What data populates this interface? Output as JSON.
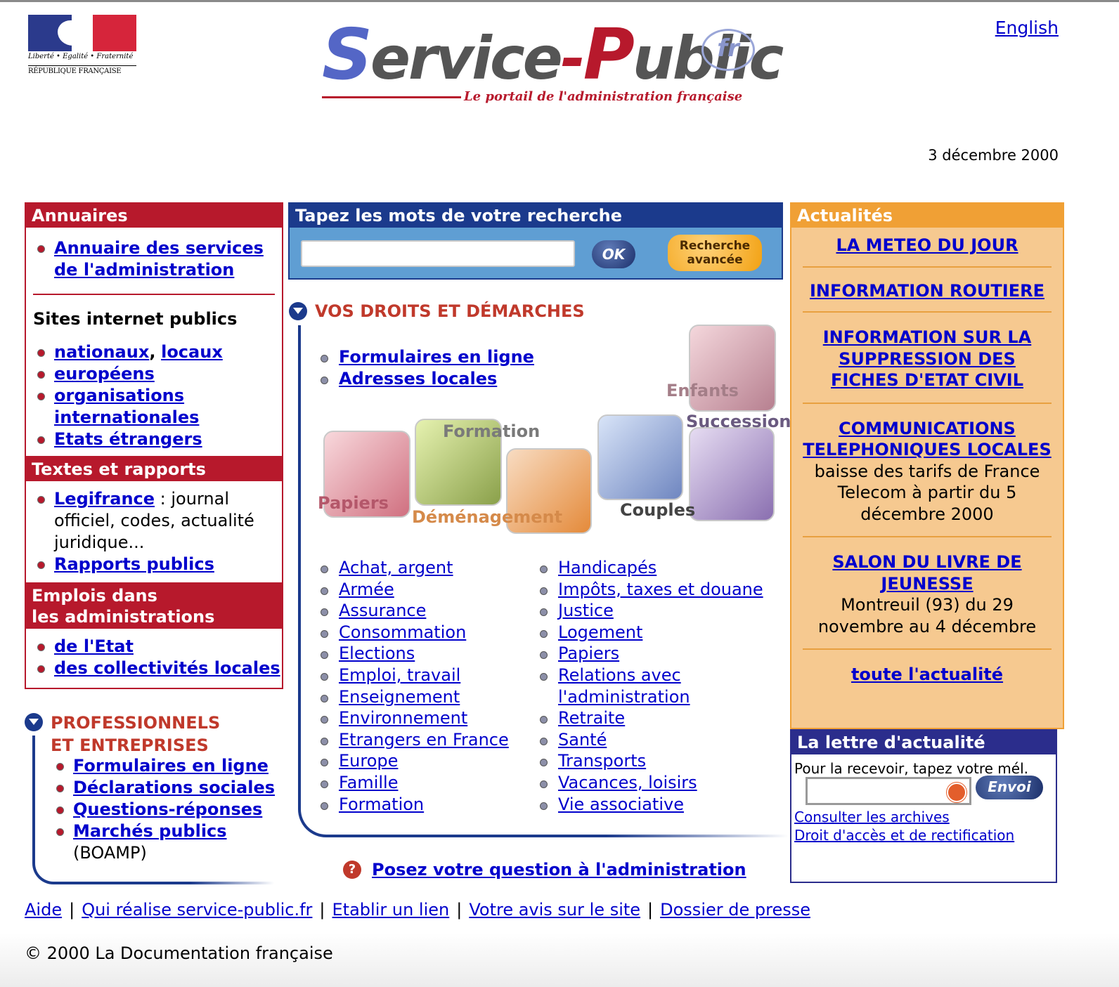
{
  "header": {
    "rf_motto": "Liberté • Egalité • Fraternité",
    "rf_name": "RÉPUBLIQUE FRANÇAISE",
    "brand_service": "Service",
    "brand_public": "Public",
    "brand_fr": "fr",
    "brand_tagline": "Le portail de l'administration française",
    "lang_link": "English",
    "date": "3 décembre 2000"
  },
  "annuaires": {
    "title": "Annuaires",
    "link": "Annuaire des services de l'administration",
    "sites_title": "Sites internet publics",
    "nationaux": "nationaux",
    "comma": ",",
    "locaux": "locaux",
    "europeens": "européens",
    "organisations": "organisations internationales",
    "etats": "Etats étrangers"
  },
  "textes": {
    "title": "Textes et rapports",
    "legifrance": "Legifrance",
    "legifrance_desc": " : journal officiel, codes, actualité juridique...",
    "rapports": "Rapports publics"
  },
  "emplois": {
    "title_line1": "Emplois dans",
    "title_line2": "les administrations",
    "etat": "de l'Etat",
    "collectivites": "des collectivités locales"
  },
  "search": {
    "title": "Tapez les mots de votre recherche",
    "input_value": "",
    "ok_label": "OK",
    "advanced_line1": "Recherche",
    "advanced_line2": "avancée"
  },
  "droits": {
    "title": "VOS DROITS ET DÉMARCHES",
    "quick_links": [
      "Formulaires en ligne",
      "Adresses locales"
    ],
    "theme_labels": {
      "enfants": "Enfants",
      "formation": "Formation",
      "succession": "Succession",
      "papiers": "Papiers",
      "demenagement": "Déménagement",
      "couples": "Couples"
    },
    "col1": [
      "Achat, argent",
      "Armée",
      "Assurance",
      "Consommation",
      "Elections",
      "Emploi, travail",
      "Enseignement",
      "Environnement",
      "Etrangers en France",
      "Europe",
      "Famille",
      "Formation"
    ],
    "col2": [
      "Handicapés",
      "Impôts, taxes et douane",
      "Justice",
      "Logement",
      "Papiers",
      "Relations avec l'administration",
      "Retraite",
      "Santé",
      "Transports",
      "Vacances, loisirs",
      "Vie associative"
    ],
    "question_link": "Posez votre question à l'administration"
  },
  "pro": {
    "title_line1": "PROFESSIONNELS",
    "title_line2": "ET ENTREPRISES",
    "links": [
      "Formulaires en ligne",
      "Déclarations sociales",
      "Questions-réponses",
      "Marchés publics"
    ],
    "boamp": "(BOAMP)"
  },
  "actualites": {
    "title": "Actualités",
    "items": [
      {
        "link": "LA METEO DU JOUR",
        "desc": ""
      },
      {
        "link": "INFORMATION ROUTIERE",
        "desc": ""
      },
      {
        "link": "INFORMATION SUR LA SUPPRESSION DES FICHES D'ETAT CIVIL",
        "desc": ""
      },
      {
        "link": "COMMUNICATIONS TELEPHONIQUES LOCALES",
        "desc": "baisse des tarifs de France Telecom à partir du 5 décembre 2000"
      },
      {
        "link": "SALON DU LIVRE DE JEUNESSE",
        "desc": "Montreuil (93) du 29 novembre au 4 décembre"
      }
    ],
    "all_link": "toute l'actualité"
  },
  "lettre": {
    "title": "La lettre d'actualité",
    "prompt": "Pour la recevoir, tapez votre mél.",
    "input_value": "",
    "envoi_label": "Envoi",
    "archives_link": "Consulter les archives",
    "droit_link": "Droit d'accès et de rectification"
  },
  "footer": {
    "links": [
      "Aide",
      "Qui réalise service-public.fr",
      "Etablir un lien",
      "Votre avis sur le site",
      "Dossier de presse"
    ],
    "separator": "|",
    "copyright": "© 2000 La Documentation française"
  },
  "colors": {
    "red": "#b7192c",
    "navy": "#1b3a8c",
    "orange": "#f0a035",
    "link": "#0000cc"
  }
}
